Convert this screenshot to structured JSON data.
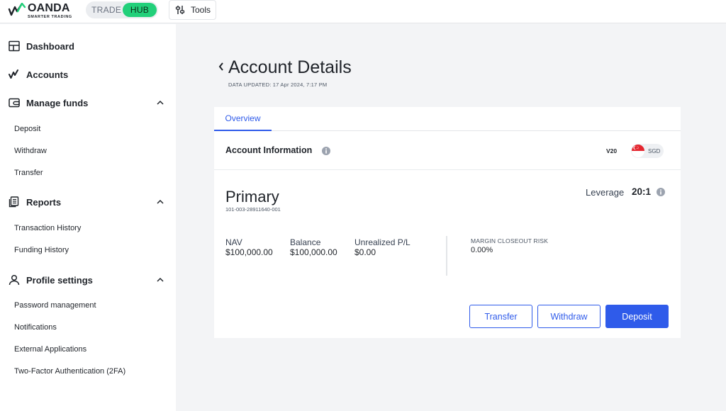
{
  "brand": {
    "name": "OANDA",
    "tagline": "SMARTER TRADING",
    "accent": "#22d07a",
    "primary": "#2f5bea"
  },
  "header": {
    "mode_switch": {
      "trade_label": "TRADE",
      "hub_label": "HUB",
      "active": "HUB"
    },
    "tools_label": "Tools",
    "tools_icon": "sliders-icon"
  },
  "sidebar": {
    "dashboard": {
      "label": "Dashboard",
      "icon": "dashboard-icon"
    },
    "accounts": {
      "label": "Accounts",
      "icon": "accounts-icon"
    },
    "manage_funds": {
      "label": "Manage funds",
      "icon": "wallet-icon",
      "expanded": true,
      "items": [
        "Deposit",
        "Withdraw",
        "Transfer"
      ]
    },
    "reports": {
      "label": "Reports",
      "icon": "report-icon",
      "expanded": true,
      "items": [
        "Transaction History",
        "Funding History"
      ]
    },
    "profile_settings": {
      "label": "Profile settings",
      "icon": "user-icon",
      "expanded": true,
      "items": [
        "Password management",
        "Notifications",
        "External Applications",
        "Two-Factor Authentication (2FA)"
      ]
    }
  },
  "page": {
    "title": "Account Details",
    "data_updated": "DATA UPDATED: 17 Apr 2024, 7:17 PM",
    "tabs": [
      "Overview"
    ],
    "active_tab": "Overview"
  },
  "account_info": {
    "heading": "Account Information",
    "platform": "V20",
    "currency": "SGD",
    "currency_flag": "singapore-flag-icon",
    "name": "Primary",
    "id": "101-003-28911640-001",
    "leverage_label": "Leverage",
    "leverage_value": "20:1",
    "stats": {
      "nav": {
        "label": "NAV",
        "value": "$100,000.00"
      },
      "balance": {
        "label": "Balance",
        "value": "$100,000.00"
      },
      "unrealized_pl": {
        "label": "Unrealized P/L",
        "value": "$0.00"
      }
    },
    "margin_closeout_risk": {
      "label": "MARGIN CLOSEOUT RISK",
      "value": "0.00%"
    },
    "actions": {
      "transfer": "Transfer",
      "withdraw": "Withdraw",
      "deposit": "Deposit"
    }
  }
}
